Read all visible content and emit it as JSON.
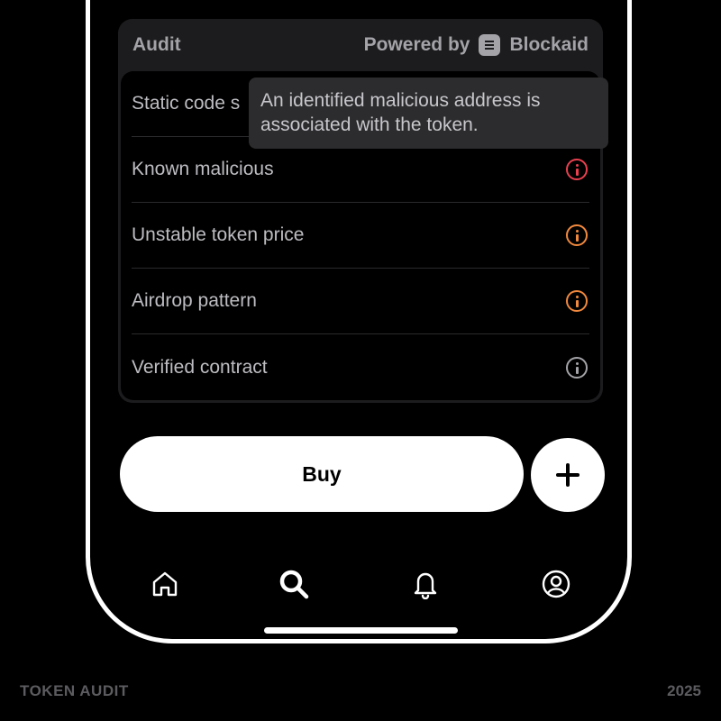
{
  "audit": {
    "title": "Audit",
    "powered_prefix": "Powered by",
    "provider": "Blockaid",
    "items": [
      {
        "label": "Static code s",
        "icon": "info-icon",
        "status_color": ""
      },
      {
        "label": "Known malicious",
        "icon": "info-icon",
        "status_color": "#e8404f"
      },
      {
        "label": "Unstable token price",
        "icon": "info-icon",
        "status_color": "#f0883e"
      },
      {
        "label": "Airdrop pattern",
        "icon": "info-icon",
        "status_color": "#f0883e"
      },
      {
        "label": "Verified contract",
        "icon": "info-icon",
        "status_color": "#a3a3a8"
      }
    ]
  },
  "tooltip": {
    "text": "An identified malicious address is associated with the token."
  },
  "actions": {
    "buy_label": "Buy",
    "add_icon": "plus-icon"
  },
  "nav": {
    "items": [
      {
        "icon": "home-icon"
      },
      {
        "icon": "search-icon",
        "active": true
      },
      {
        "icon": "bell-icon"
      },
      {
        "icon": "profile-icon"
      }
    ]
  },
  "footer": {
    "left": "TOKEN AUDIT",
    "right": "2025"
  },
  "colors": {
    "background": "#000000",
    "card": "#1c1c1e",
    "danger": "#e8404f",
    "warning": "#f0883e",
    "neutral": "#a3a3a8"
  }
}
